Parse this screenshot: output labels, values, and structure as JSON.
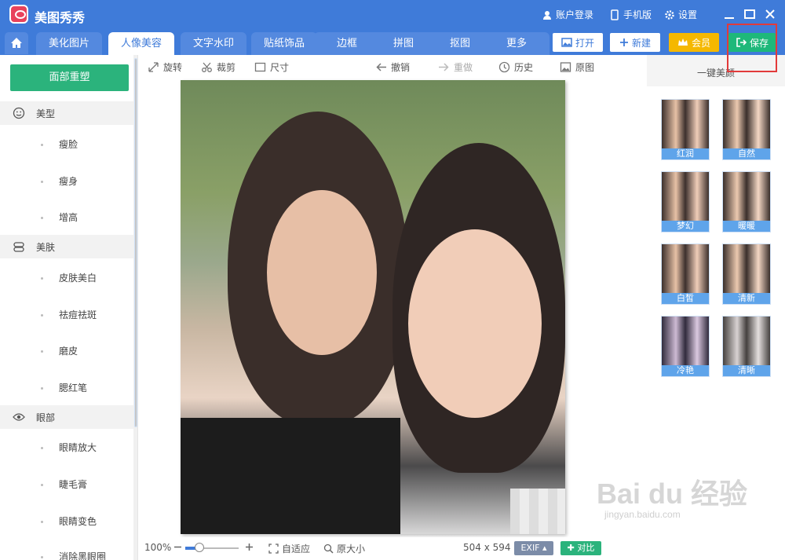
{
  "app": {
    "title": "美图秀秀"
  },
  "titlebar": {
    "login": "账户登录",
    "mobile": "手机版",
    "settings": "设置"
  },
  "tabs": [
    "美化图片",
    "人像美容",
    "文字水印",
    "贴纸饰品",
    "边框",
    "拼图",
    "抠图",
    "更多"
  ],
  "active_tab": "人像美容",
  "header_buttons": {
    "open": "打开",
    "new": "新建",
    "vip": "会员",
    "save": "保存"
  },
  "left_panel": {
    "reset": "面部重塑",
    "sections": [
      {
        "title": "美型",
        "icon": "smile-icon",
        "items": [
          "瘦脸",
          "瘦身",
          "增高"
        ]
      },
      {
        "title": "美肤",
        "icon": "skin-icon",
        "items": [
          "皮肤美白",
          "祛痘祛斑",
          "磨皮",
          "腮红笔"
        ]
      },
      {
        "title": "眼部",
        "icon": "eye-icon",
        "items": [
          "眼睛放大",
          "睫毛膏",
          "眼睛变色",
          "消除黑眼圈"
        ]
      }
    ]
  },
  "toolbar": {
    "rotate": "旋转",
    "crop": "裁剪",
    "size": "尺寸",
    "undo": "撤销",
    "redo": "重做",
    "history": "历史",
    "original": "原图"
  },
  "right_panel": {
    "title": "一键美颜",
    "presets": [
      "红润",
      "自然",
      "梦幻",
      "暖暖",
      "白皙",
      "清新",
      "冷艳",
      "清晰"
    ]
  },
  "statusbar": {
    "zoom": "100%",
    "fit": "自适应",
    "actual": "原大小",
    "dimensions": "504 x 594",
    "exif": "EXIF",
    "compare": "对比"
  },
  "watermark": {
    "brand": "Bai du 经验",
    "url": "jingyan.baidu.com"
  },
  "colors": {
    "primary": "#3f7bd9",
    "save": "#1eb87a",
    "vip": "#f5b800",
    "reset": "#2bb37c",
    "highlight": "#e23a3a"
  }
}
